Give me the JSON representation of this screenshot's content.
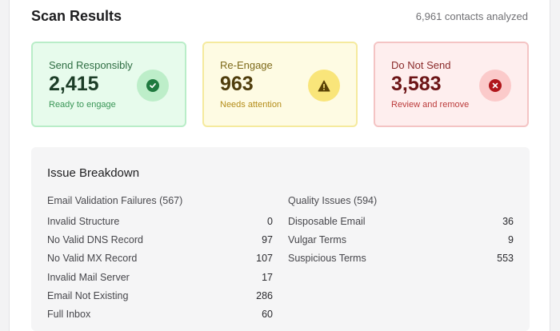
{
  "header": {
    "title": "Scan Results",
    "meta": "6,961 contacts analyzed"
  },
  "cards": {
    "send": {
      "label": "Send Responsibly",
      "value": "2,415",
      "sub": "Ready to engage",
      "icon": "check-circle-icon",
      "accent": "#1f7a3f"
    },
    "reengage": {
      "label": "Re-Engage",
      "value": "963",
      "sub": "Needs attention",
      "icon": "warning-triangle-icon",
      "accent": "#5a4306"
    },
    "donotsend": {
      "label": "Do Not Send",
      "value": "3,583",
      "sub": "Review and remove",
      "icon": "x-circle-icon",
      "accent": "#b0161b"
    }
  },
  "breakdown": {
    "title": "Issue Breakdown",
    "validation": {
      "heading": "Email Validation Failures (567)",
      "rows": [
        {
          "label": "Invalid Structure",
          "value": "0"
        },
        {
          "label": "No Valid DNS Record",
          "value": "97"
        },
        {
          "label": "No Valid MX Record",
          "value": "107"
        },
        {
          "label": "Invalid Mail Server",
          "value": "17"
        },
        {
          "label": "Email Not Existing",
          "value": "286"
        },
        {
          "label": "Full Inbox",
          "value": "60"
        }
      ]
    },
    "quality": {
      "heading": "Quality Issues (594)",
      "rows": [
        {
          "label": "Disposable Email",
          "value": "36"
        },
        {
          "label": "Vulgar Terms",
          "value": "9"
        },
        {
          "label": "Suspicious Terms",
          "value": "553"
        }
      ]
    }
  }
}
